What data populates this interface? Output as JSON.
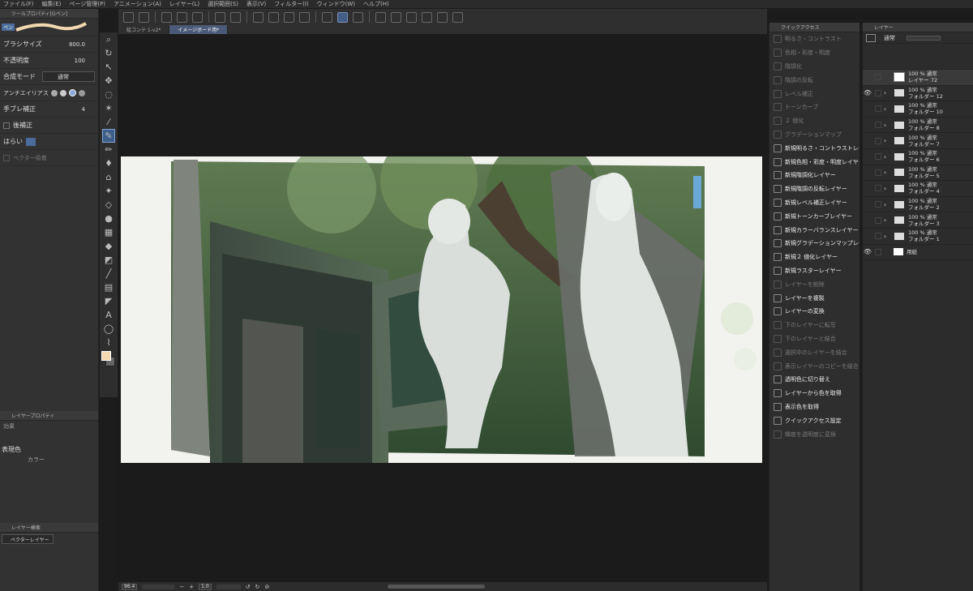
{
  "menu": [
    "ファイル(F)",
    "編集(E)",
    "ページ管理(P)",
    "アニメーション(A)",
    "レイヤー(L)",
    "選択範囲(S)",
    "表示(V)",
    "フィルター(I)",
    "ウィンドウ(W)",
    "ヘルプ(H)"
  ],
  "tool_property": {
    "header": "ツールプロパティ[Gペン]",
    "brush_label": "ペン",
    "brush_size_label": "ブラシサイズ",
    "brush_size_value": "800.0",
    "opacity_label": "不透明度",
    "opacity_value": "100",
    "blend_label": "合成モード",
    "blend_value": "通常",
    "aa_label": "アンチエイリアス",
    "stabilize_label": "手ブレ補正",
    "stabilize_value": "4",
    "post_label": "後補正",
    "taper_label": "はらい",
    "vector_label": "ベクター吸着"
  },
  "layer_property": {
    "header": "レイヤープロパティ",
    "effect_label": "効果",
    "color_label": "表現色",
    "color_value": "カラー"
  },
  "layer_search": {
    "header": "レイヤー検索",
    "filter_value": "ベクターレイヤー"
  },
  "canvas": {
    "tabs": [
      "絵コンテ 1-v2*",
      "イメージボード用*"
    ]
  },
  "status": {
    "zoom": "96.4",
    "angle": "1.0"
  },
  "quick_access": {
    "header": "クイックアクセス",
    "items": [
      {
        "label": "明るさ・コントラスト",
        "enabled": false
      },
      {
        "label": "色相・彩度・明度",
        "enabled": false
      },
      {
        "label": "階調化",
        "enabled": false
      },
      {
        "label": "階調の反転",
        "enabled": false
      },
      {
        "label": "レベル補正",
        "enabled": false
      },
      {
        "label": "トーンカーブ",
        "enabled": false
      },
      {
        "label": "２ 値化",
        "enabled": false
      },
      {
        "label": "グラデーションマップ",
        "enabled": false
      },
      {
        "label": "新規明るさ・コントラストレイヤー",
        "enabled": true
      },
      {
        "label": "新規色相・彩度・明度レイヤー",
        "enabled": true
      },
      {
        "label": "新規階調化レイヤー",
        "enabled": true
      },
      {
        "label": "新規階調の反転レイヤー",
        "enabled": true
      },
      {
        "label": "新規レベル補正レイヤー",
        "enabled": true
      },
      {
        "label": "新規トーンカーブレイヤー",
        "enabled": true
      },
      {
        "label": "新規カラーバランスレイヤー",
        "enabled": true
      },
      {
        "label": "新規グラデーションマップレイヤー",
        "enabled": true
      },
      {
        "label": "新規２ 値化レイヤー",
        "enabled": true
      },
      {
        "label": "新規ラスターレイヤー",
        "enabled": true
      },
      {
        "label": "レイヤーを削除",
        "enabled": false
      },
      {
        "label": "レイヤーを複製",
        "enabled": true
      },
      {
        "label": "レイヤーの変換",
        "enabled": true
      },
      {
        "label": "下のレイヤーに転写",
        "enabled": false
      },
      {
        "label": "下のレイヤーと結合",
        "enabled": false
      },
      {
        "label": "選択中のレイヤーを結合",
        "enabled": false
      },
      {
        "label": "表示レイヤーのコピーを結合",
        "enabled": false
      },
      {
        "label": "透明色に切り替え",
        "enabled": true
      },
      {
        "label": "レイヤーから色を取得",
        "enabled": true
      },
      {
        "label": "表示色を取得",
        "enabled": true
      },
      {
        "label": "クイックアクセス設定",
        "enabled": true
      },
      {
        "label": "輝度を透明度に変換",
        "enabled": false
      }
    ]
  },
  "layers": {
    "header": "レイヤー",
    "blend_mode": "通常",
    "rows": [
      {
        "line1": "100 % 通常",
        "line2": "レイヤー 72",
        "kind": "layer",
        "visible": false,
        "selected": true
      },
      {
        "line1": "100 % 通常",
        "line2": "フォルダー 12",
        "kind": "folder",
        "visible": true
      },
      {
        "line1": "100 % 通常",
        "line2": "フォルダー 10",
        "kind": "folder",
        "visible": false
      },
      {
        "line1": "100 % 通常",
        "line2": "フォルダー 8",
        "kind": "folder",
        "visible": false
      },
      {
        "line1": "100 % 通常",
        "line2": "フォルダー 7",
        "kind": "folder",
        "visible": false
      },
      {
        "line1": "100 % 通常",
        "line2": "フォルダー 6",
        "kind": "folder",
        "visible": false
      },
      {
        "line1": "100 % 通常",
        "line2": "フォルダー 5",
        "kind": "folder",
        "visible": false
      },
      {
        "line1": "100 % 通常",
        "line2": "フォルダー 4",
        "kind": "folder",
        "visible": false
      },
      {
        "line1": "100 % 通常",
        "line2": "フォルダー 2",
        "kind": "folder",
        "visible": false
      },
      {
        "line1": "100 % 通常",
        "line2": "フォルダー 3",
        "kind": "folder",
        "visible": false
      },
      {
        "line1": "100 % 通常",
        "line2": "フォルダー 1",
        "kind": "folder",
        "visible": false
      },
      {
        "line1": "",
        "line2": "用紙",
        "kind": "paper",
        "visible": true
      }
    ]
  },
  "colors": {
    "accent": "#4a6b9c",
    "main_color": "#f3d9b0"
  }
}
